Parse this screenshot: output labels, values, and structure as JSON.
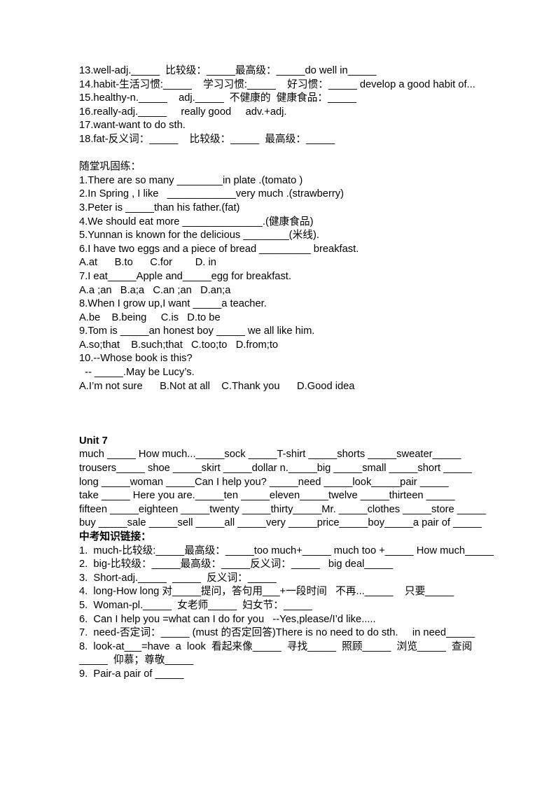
{
  "document": {
    "vocab_section": {
      "lines": [
        "13.well-adj._____  比较级：_____最高级：_____do well in_____",
        "14.habit-生活习惯:_____    学习习惯:_____    好习惯：_____ develop a good habit of...",
        "15.healthy-n._____    adj._____  不健康的  健康食品：_____",
        "16.really-adj._____     really good     adv.+adj.",
        "17.want-want to do sth.",
        "18.fat-反义词：_____    比较级：_____  最高级：_____"
      ]
    },
    "practice_section": {
      "heading": "随堂巩固练：",
      "lines": [
        "1.There are so many ________in plate .(tomato )",
        "2.In Spring , I like   ____________very much .(strawberry)",
        "3.Peter is _____than his father.(fat)",
        "4.We should eat more ______________.(健康食品)",
        "5.Yunnan is known for the delicious ________(米线).",
        "6.I have two eggs and a piece of bread _________ breakfast.",
        "A.at      B.to      C.for        D. in",
        "7.I eat_____Apple and_____egg for breakfast.",
        "A.a ;an   B.a;a   C.an ;an   D.an;a",
        "8.When I grow up,I want _____a teacher.",
        "A.be    B.being     C.is   D.to be",
        "9.Tom is _____an honest boy _____ we all like him.",
        "A.so;that    B.such;that   C.too;to   D.from;to",
        "10.--Whose book is this?",
        "  -- _____.May be Lucy’s.",
        "A.I’m not sure      B.Not at all    C.Thank you      D.Good idea"
      ]
    },
    "unit7_section": {
      "heading": "Unit 7",
      "lines": [
        "much _____ How much..._____sock _____T-shirt _____shorts _____sweater_____",
        "trousers_____ shoe _____skirt _____dollar n._____big _____small _____short _____",
        "long _____woman _____Can I help you? _____need _____look_____pair _____",
        "take _____ Here you are._____ten _____eleven_____twelve _____thirteen _____",
        "fifteen _____eighteen _____twenty _____thirty_____Mr. _____clothes _____store _____",
        "buy _____sale _____sell _____all _____very _____price_____boy_____a pair of _____"
      ]
    },
    "zhongkao_section": {
      "heading": "中考知识链接：",
      "items": [
        "1.  much-比较级:_____最高级：_____too much+_____ much too +_____ How much_____",
        "2.  big-比较级：_____最高级：_____反义词：_____   big deal_____",
        "3.  Short-adj._____  _____  反义词：_____",
        "4.  long-How long 对_____提问，答句用___+一段时间   不再..._____    只要_____",
        "5.  Woman-pl._____  女老师_____  妇女节：_____",
        "6.  Can I help you =what can I do for you   --Yes,please/I’d like.....",
        "7.  need-否定词：_____ (must 的否定回答)There is no need to do sth.     in need_____",
        "8.  look-at___=have  a  look  看起来像_____  寻找_____  照顾_____  浏览_____  查阅",
        "_____  仰慕；尊敬_____",
        "9.  Pair-a pair of _____"
      ]
    }
  }
}
